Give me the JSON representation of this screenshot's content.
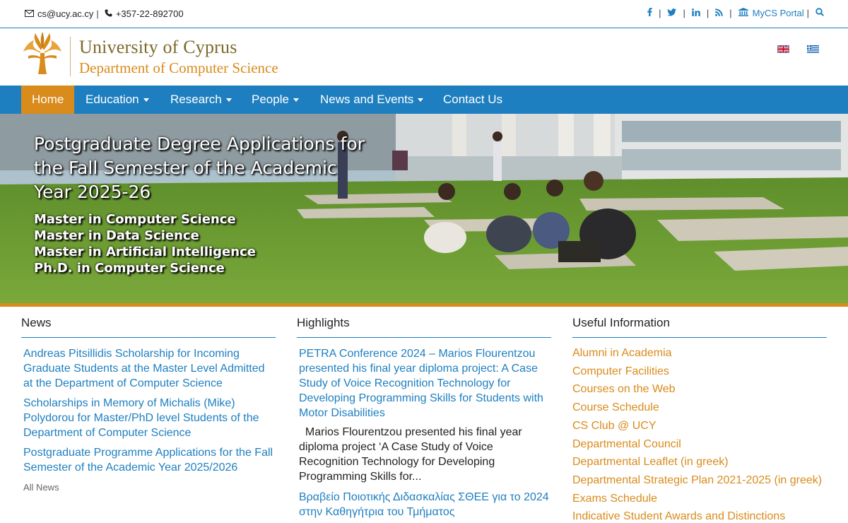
{
  "topbar": {
    "email": "cs@ucy.ac.cy",
    "phone": "+357-22-892700",
    "sep": "|",
    "social": {
      "facebook": "f",
      "twitter": "t",
      "linkedin": "in",
      "rss": "rss"
    },
    "portal": "MyCS Portal"
  },
  "header": {
    "university": "University of Cyprus",
    "department": "Department of Computer Science",
    "languages": [
      "English",
      "Greek"
    ]
  },
  "nav": {
    "items": [
      {
        "label": "Home",
        "active": true
      },
      {
        "label": "Education"
      },
      {
        "label": "Research"
      },
      {
        "label": "People"
      },
      {
        "label": "News and Events"
      },
      {
        "label": "Contact Us"
      }
    ]
  },
  "hero": {
    "title": "Postgraduate Degree Applications for the Fall Semester of the Academic Year 2025-26",
    "programs": [
      "Master in Computer Science",
      "Master in Data Science",
      "Master in Artificial Intelligence",
      "Ph.D. in Computer Science"
    ]
  },
  "news": {
    "heading": "News",
    "items": [
      "Andreas Pitsillidis Scholarship for Incoming Graduate Students at the Master Level Admitted at the Department of Computer Science",
      "Scholarships in Memory of Michalis (Mike) Polydorou for Master/PhD level Students of the Department of Computer Science",
      "Postgraduate Programme Applications for the Fall Semester of the Academic Year 2025/2026"
    ],
    "all": "All News"
  },
  "highlights": {
    "heading": "Highlights",
    "items": [
      {
        "title": "PETRA Conference 2024 – Marios Flourentzou presented his final year diploma project: A Case Study of Voice Recognition Technology for Developing Programming Skills for Students with Motor Disabilities",
        "summary": "  Marios Flourentzou presented his final year diploma project ‘A Case Study of Voice Recognition Technology for Developing Programming Skills for..."
      },
      {
        "title": "Βραβείο Ποιοτικής Διδασκαλίας ΣΘΕΕ για το 2024 στην Καθηγήτρια του Τμήματος"
      }
    ]
  },
  "useful": {
    "heading": "Useful Information",
    "items": [
      "Alumni in Academia",
      "Computer Facilities",
      "Courses on the Web",
      "Course Schedule",
      "CS Club @ UCY",
      "Departmental Council",
      "Departmental Leaflet (in greek)",
      "Departmental Strategic Plan 2021-2025 (in greek)",
      "Exams Schedule",
      "Indicative Student Awards and Distinctions"
    ]
  },
  "colors": {
    "primary_blue": "#1e7fc0",
    "accent_orange": "#d98b1c"
  },
  "icons": [
    "envelope-icon",
    "phone-icon",
    "facebook-icon",
    "twitter-icon",
    "linkedin-icon",
    "rss-icon",
    "bank-icon",
    "search-icon",
    "caret-down-icon"
  ]
}
